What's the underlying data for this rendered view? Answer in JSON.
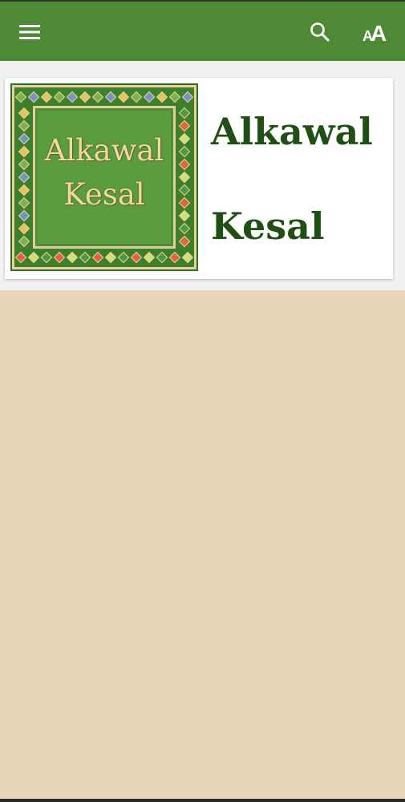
{
  "toolbar": {
    "menu_icon": "hamburger-menu-icon",
    "search_icon": "search-icon",
    "font_size_icon": "font-size-icon",
    "font_size_label": "AA",
    "background_color": "#4e8a36"
  },
  "book": {
    "cover_line1": "Alkawal",
    "cover_line2": "Kesal",
    "title_line1": "Alkawal",
    "title_line2": "Kesal",
    "title_color": "#1f4f14"
  },
  "page": {
    "background_color": "#e9d5b8"
  }
}
